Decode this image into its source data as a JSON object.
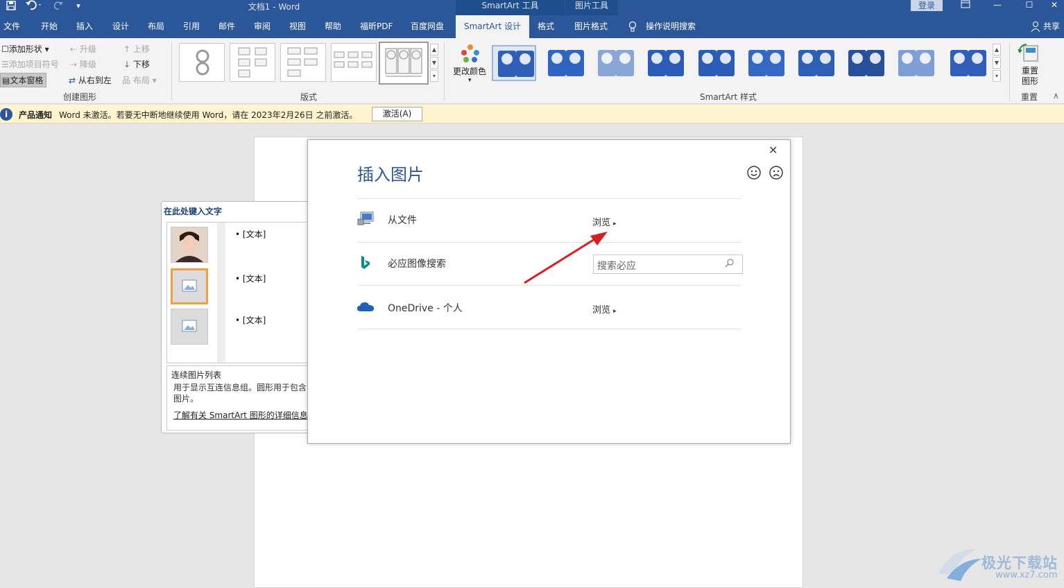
{
  "window": {
    "title": "文档1 - Word",
    "login_label": "登录",
    "share_label": "共享",
    "context_groups": [
      {
        "label": "SmartArt 工具"
      },
      {
        "label": "图片工具"
      }
    ],
    "qa_icons": [
      "save-icon",
      "undo-icon",
      "redo-icon",
      "customize-icon"
    ]
  },
  "tabs": [
    {
      "label": "文件"
    },
    {
      "label": "开始"
    },
    {
      "label": "插入"
    },
    {
      "label": "设计"
    },
    {
      "label": "布局"
    },
    {
      "label": "引用"
    },
    {
      "label": "邮件"
    },
    {
      "label": "审阅"
    },
    {
      "label": "视图"
    },
    {
      "label": "帮助"
    },
    {
      "label": "福昕PDF"
    },
    {
      "label": "百度网盘"
    },
    {
      "label": "SmartArt 设计",
      "active": true
    },
    {
      "label": "格式"
    },
    {
      "label": "图片格式"
    },
    {
      "label": "操作说明搜索"
    }
  ],
  "ribbon": {
    "create_group": {
      "label": "创建图形",
      "add_shape": "添加形状",
      "add_bullet": "添加项目符号",
      "text_pane": "文本窗格",
      "promote": "升级",
      "demote": "降级",
      "rtl": "从右到左",
      "move_up": "上移",
      "move_down": "下移",
      "layout": "布局"
    },
    "layouts_group": {
      "label": "版式"
    },
    "change_colors": "更改颜色",
    "styles_group": {
      "label": "SmartArt 样式"
    },
    "reset_group": {
      "label": "重置",
      "reset_graphic": "重置图形"
    },
    "style_colors": [
      "#2f5fb8",
      "#2f64c2",
      "#8aa6d6",
      "#2a5cb8",
      "#2a5cb8",
      "#3568c4",
      "#2d5fb6",
      "#28509a",
      "#7f9dd6",
      "#2f5fb8"
    ]
  },
  "notice": {
    "title": "产品通知",
    "message": "Word 未激活。若要无中断地继续使用 Word，请在 2023年2月26日 之前激活。",
    "button": "激活(A)"
  },
  "text_pane": {
    "title": "在此处键入文字",
    "bullets": [
      "[文本]",
      "[文本]",
      "[文本]"
    ],
    "desc_title": "连续图片列表",
    "desc_body": "用于显示互连信息组。圆形用于包含图片。",
    "link": "了解有关 SmartArt 图形的详细信息"
  },
  "dialog": {
    "title": "插入图片",
    "rows": [
      {
        "label": "从文件",
        "action": "浏览"
      },
      {
        "label": "必应图像搜索",
        "placeholder": "搜索必应"
      },
      {
        "label": "OneDrive - 个人",
        "action": "浏览"
      }
    ]
  },
  "watermark": {
    "text": "极光下载站",
    "url": "www.xz7.com"
  }
}
